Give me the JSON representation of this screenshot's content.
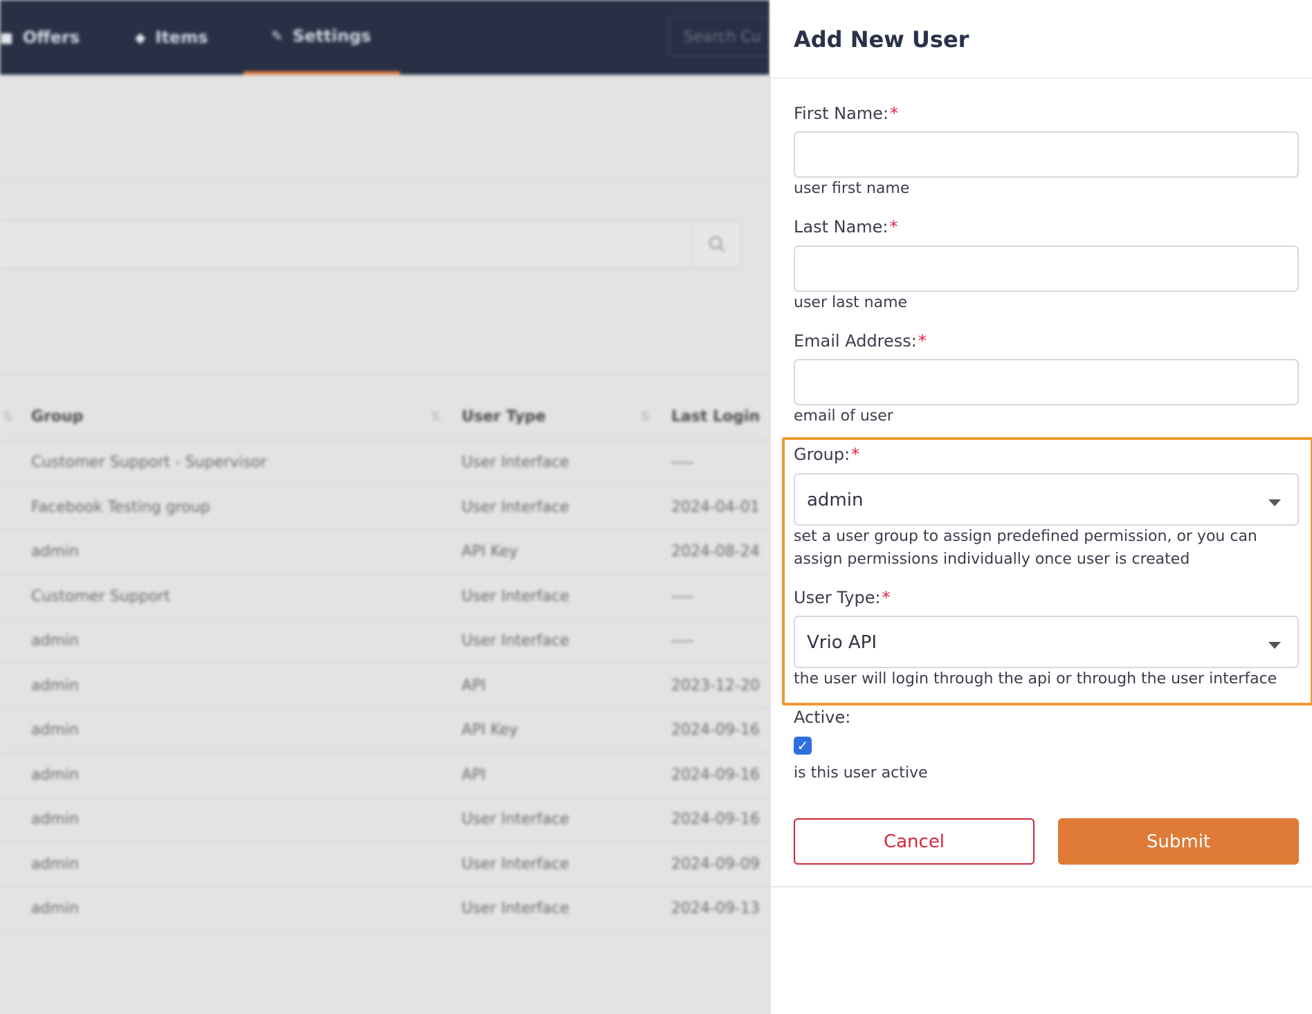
{
  "background": {
    "nav": [
      {
        "icon": "box-icon",
        "glyph": "■",
        "label": "Offers"
      },
      {
        "icon": "tag-icon",
        "glyph": "◆",
        "label": "Items"
      },
      {
        "icon": "wrench-icon",
        "glyph": "✎",
        "label": "Settings"
      }
    ],
    "search_placeholder": "Search Cu",
    "table": {
      "columns": [
        "Group",
        "User Type",
        "Last Login"
      ],
      "rows": [
        [
          "Customer Support - Supervisor",
          "User Interface",
          "----"
        ],
        [
          "Facebook Testing group",
          "User Interface",
          "2024-04-01"
        ],
        [
          "admin",
          "API Key",
          "2024-08-24"
        ],
        [
          "Customer Support",
          "User Interface",
          "----"
        ],
        [
          "admin",
          "User Interface",
          "----"
        ],
        [
          "admin",
          "API",
          "2023-12-20"
        ],
        [
          "admin",
          "API Key",
          "2024-09-16"
        ],
        [
          "admin",
          "API",
          "2024-09-16"
        ],
        [
          "admin",
          "User Interface",
          "2024-09-16"
        ],
        [
          "admin",
          "User Interface",
          "2024-09-09"
        ],
        [
          "admin",
          "User Interface",
          "2024-09-13"
        ]
      ]
    }
  },
  "drawer": {
    "title": "Add New User",
    "first_name": {
      "label": "First Name:",
      "required": "*",
      "value": "",
      "help": "user first name"
    },
    "last_name": {
      "label": "Last Name:",
      "required": "*",
      "value": "",
      "help": "user last name"
    },
    "email": {
      "label": "Email Address:",
      "required": "*",
      "value": "",
      "help": "email of user"
    },
    "group": {
      "label": "Group:",
      "required": "*",
      "value": "admin",
      "help_line1": "set a user group to assign predefined permission, or you can",
      "help_line2": "assign permissions individually once user is created"
    },
    "user_type": {
      "label": "User Type:",
      "required": "*",
      "value": "Vrio API",
      "help": "the user will login through the api or through the user interface"
    },
    "active": {
      "label": "Active:",
      "checked": true,
      "check_glyph": "✓",
      "help": "is this user active"
    },
    "cancel_label": "Cancel",
    "submit_label": "Submit"
  },
  "colors": {
    "nav_bg": "#283046",
    "accent": "#e07a37",
    "highlight": "#f0992f",
    "cancel": "#d3273d",
    "checkbox": "#2f6fe0",
    "required": "#e0244c"
  }
}
